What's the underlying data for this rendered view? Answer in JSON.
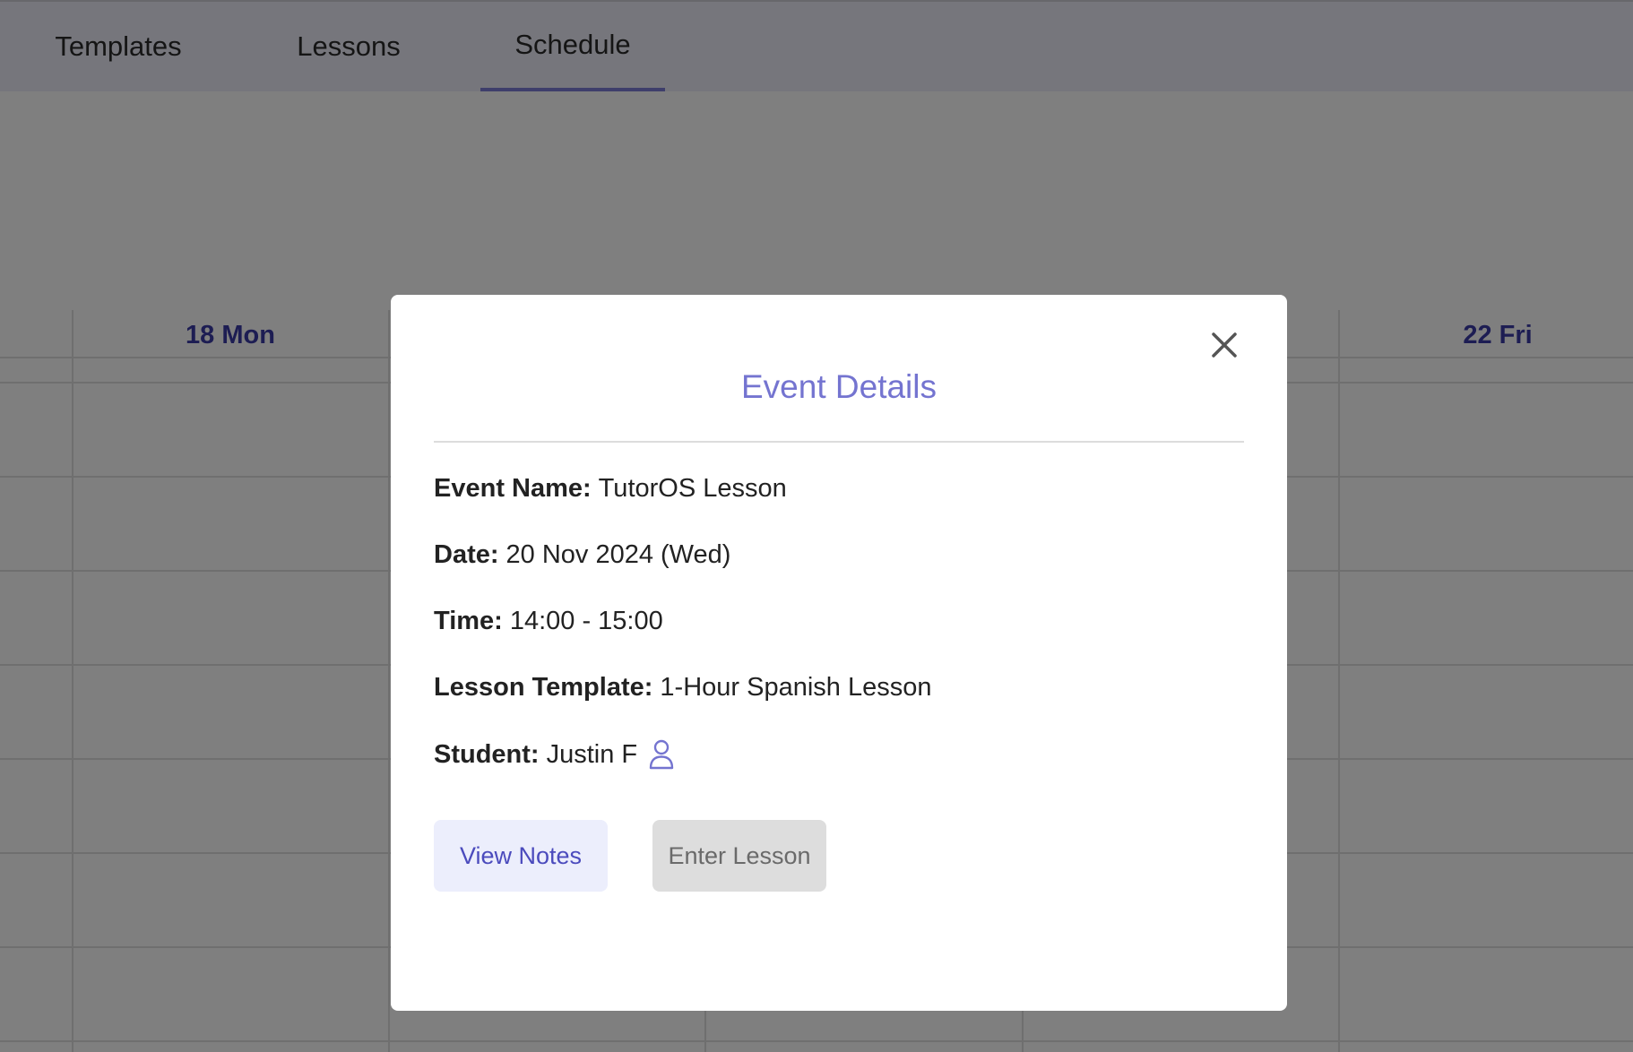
{
  "nav": {
    "tabs": [
      {
        "label": "Templates"
      },
      {
        "label": "Lessons"
      },
      {
        "label": "Schedule"
      }
    ]
  },
  "calendar": {
    "day_headers": [
      {
        "label": "18 Mon"
      },
      {
        "label": "22 Fri"
      }
    ]
  },
  "modal": {
    "title": "Event Details",
    "fields": {
      "event_name": {
        "label": "Event Name:",
        "value": "TutorOS Lesson"
      },
      "date": {
        "label": "Date:",
        "value": "20 Nov 2024 (Wed)"
      },
      "time": {
        "label": "Time:",
        "value": "14:00 - 15:00"
      },
      "lesson_template": {
        "label": "Lesson Template:",
        "value": "1-Hour Spanish Lesson"
      },
      "student": {
        "label": "Student:",
        "value": "Justin F",
        "icon": "user-icon"
      }
    },
    "buttons": {
      "view_notes": "View Notes",
      "enter_lesson": "Enter Lesson"
    },
    "close_icon": "close-icon"
  },
  "colors": {
    "accent": "#7474d0",
    "day_header": "#3a3aa6",
    "overlay": "rgba(0,0,0,0.5)",
    "view_notes_bg": "#eceefc",
    "enter_lesson_bg": "#dddddd"
  }
}
